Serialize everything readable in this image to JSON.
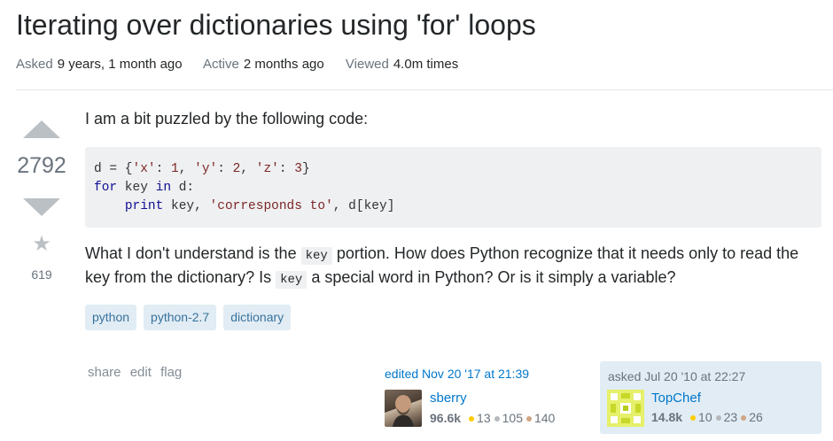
{
  "question": {
    "title": "Iterating over dictionaries using 'for' loops",
    "meta": {
      "asked_label": "Asked",
      "asked_value": "9 years, 1 month ago",
      "active_label": "Active",
      "active_value": "2 months ago",
      "viewed_label": "Viewed",
      "viewed_value": "4.0m times"
    },
    "votes": {
      "score": "2792",
      "favorites": "619"
    },
    "body": {
      "intro": "I am a bit puzzled by the following code:",
      "p2_part1": "What I don't understand is the",
      "p2_code1": "key",
      "p2_part2": "portion. How does Python recognize that it needs only to read the key from the dictionary? Is",
      "p2_code2": "key",
      "p2_part3": "a special word in Python? Or is it simply a variable?"
    },
    "code": {
      "l1_a": "d = {",
      "l1_s1": "'x'",
      "l1_b": ": ",
      "l1_n1": "1",
      "l1_c": ", ",
      "l1_s2": "'y'",
      "l1_d": ": ",
      "l1_n2": "2",
      "l1_e": ", ",
      "l1_s3": "'z'",
      "l1_f": ": ",
      "l1_n3": "3",
      "l1_g": "}",
      "l2_kw1": "for",
      "l2_a": " key ",
      "l2_kw2": "in",
      "l2_b": " d:",
      "l3_indent": "    ",
      "l3_kw": "print",
      "l3_a": " key, ",
      "l3_s": "'corresponds to'",
      "l3_b": ", d[key]"
    },
    "tags": [
      "python",
      "python-2.7",
      "dictionary"
    ],
    "post_menu": {
      "share": "share",
      "edit": "edit",
      "flag": "flag"
    },
    "edited": {
      "when": "edited Nov 20 '17 at 21:39",
      "user": {
        "name": "sberry",
        "rep": "96.6k",
        "gold": "13",
        "silver": "105",
        "bronze": "140"
      }
    },
    "asked": {
      "when": "asked Jul 20 '10 at 22:27",
      "user": {
        "name": "TopChef",
        "rep": "14.8k",
        "gold": "10",
        "silver": "23",
        "bronze": "26"
      }
    }
  },
  "colors": {
    "link": "#0077cc",
    "tag_bg": "#e1ecf4",
    "tag_text": "#39739d",
    "code_bg": "#eff0f1",
    "arrow": "#bbc0c4"
  },
  "icons": {
    "upvote": "triangle-up",
    "downvote": "triangle-down",
    "favorite": "star"
  }
}
